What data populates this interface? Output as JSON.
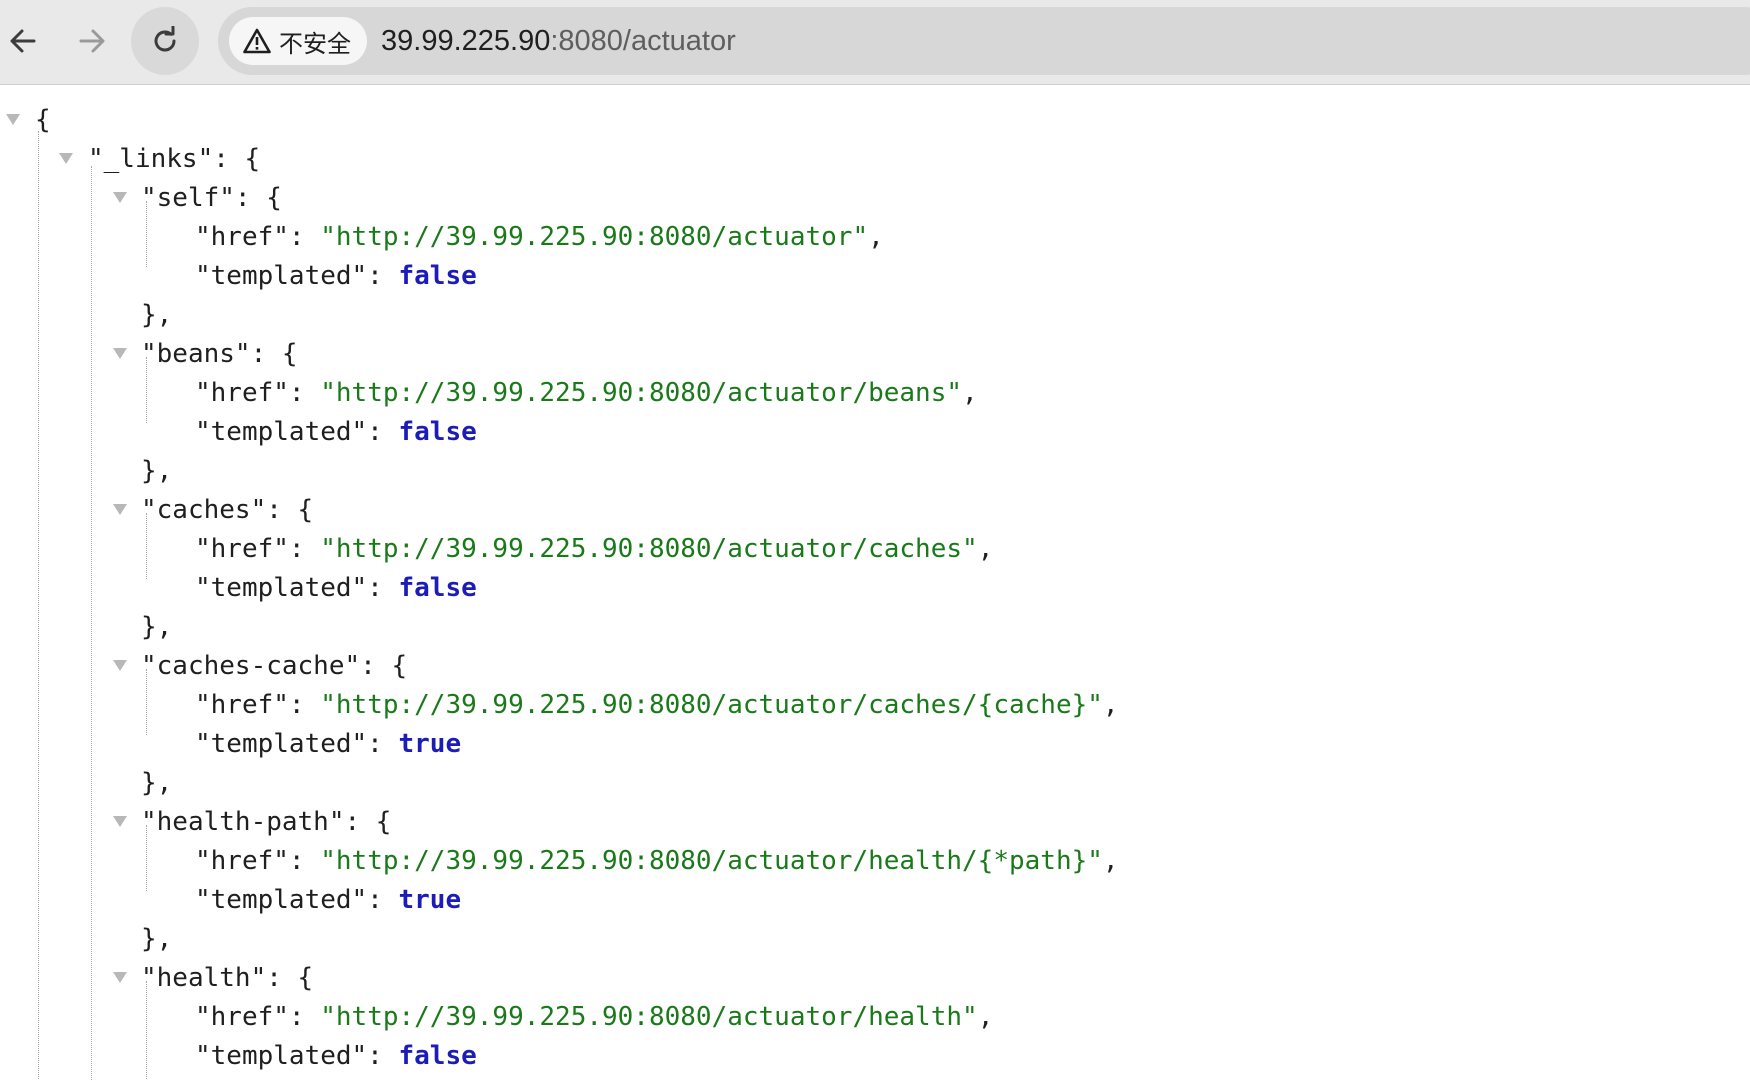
{
  "browser": {
    "security_label": "不安全",
    "url_host": "39.99.225.90",
    "url_path": ":8080/actuator"
  },
  "json": {
    "root_open": "{",
    "links_key": "\"_links\": {",
    "entries": [
      {
        "key_line": "\"self\": {",
        "href_key": "\"href\": ",
        "href_value": "\"http://39.99.225.90:8080/actuator\"",
        "comma": ",",
        "templated_key": "\"templated\": ",
        "templated_value": "false",
        "close": "},"
      },
      {
        "key_line": "\"beans\": {",
        "href_key": "\"href\": ",
        "href_value": "\"http://39.99.225.90:8080/actuator/beans\"",
        "comma": ",",
        "templated_key": "\"templated\": ",
        "templated_value": "false",
        "close": "},"
      },
      {
        "key_line": "\"caches\": {",
        "href_key": "\"href\": ",
        "href_value": "\"http://39.99.225.90:8080/actuator/caches\"",
        "comma": ",",
        "templated_key": "\"templated\": ",
        "templated_value": "false",
        "close": "},"
      },
      {
        "key_line": "\"caches-cache\": {",
        "href_key": "\"href\": ",
        "href_value": "\"http://39.99.225.90:8080/actuator/caches/{cache}\"",
        "comma": ",",
        "templated_key": "\"templated\": ",
        "templated_value": "true",
        "close": "},"
      },
      {
        "key_line": "\"health-path\": {",
        "href_key": "\"href\": ",
        "href_value": "\"http://39.99.225.90:8080/actuator/health/{*path}\"",
        "comma": ",",
        "templated_key": "\"templated\": ",
        "templated_value": "true",
        "close": "},"
      },
      {
        "key_line": "\"health\": {",
        "href_key": "\"href\": ",
        "href_value": "\"http://39.99.225.90:8080/actuator/health\"",
        "comma": ",",
        "templated_key": "\"templated\": ",
        "templated_value": "false"
      }
    ]
  },
  "colors": {
    "string": "#1a7a1a",
    "boolean": "#1c1cb8",
    "toggle": "#b8b8b8"
  }
}
